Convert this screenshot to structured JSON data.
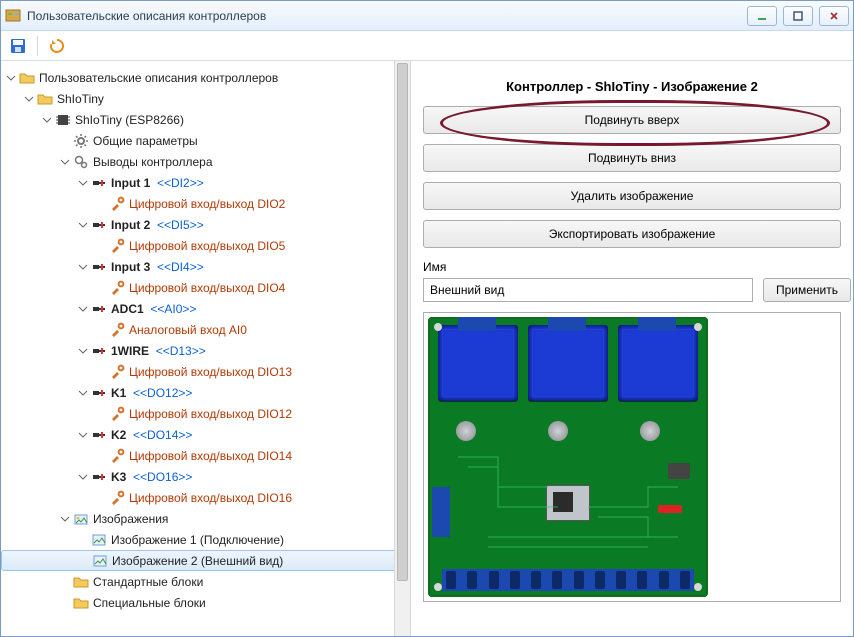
{
  "window": {
    "title": "Пользовательские описания контроллеров"
  },
  "toolbar": {
    "save": "save",
    "refresh": "refresh"
  },
  "tree": {
    "root": "Пользовательские описания контроллеров",
    "controller": "ShIoTiny",
    "device": "ShIoTiny (ESP8266)",
    "common_params": "Общие параметры",
    "pins": "Выводы контроллера",
    "nodes": [
      {
        "name": "Input 1",
        "tag": "<<DI2>>",
        "sub": "Цифровой вход/выход DIO2"
      },
      {
        "name": "Input 2",
        "tag": "<<DI5>>",
        "sub": "Цифровой вход/выход DIO5"
      },
      {
        "name": "Input 3",
        "tag": "<<DI4>>",
        "sub": "Цифровой вход/выход DIO4"
      },
      {
        "name": "ADC1",
        "tag": "<<AI0>>",
        "sub": "Аналоговый вход AI0"
      },
      {
        "name": "1WIRE",
        "tag": "<<D13>>",
        "sub": "Цифровой вход/выход DIO13"
      },
      {
        "name": "K1",
        "tag": "<<DO12>>",
        "sub": "Цифровой вход/выход DIO12"
      },
      {
        "name": "K2",
        "tag": "<<DO14>>",
        "sub": "Цифровой вход/выход DIO14"
      },
      {
        "name": "K3",
        "tag": "<<DO16>>",
        "sub": "Цифровой вход/выход DIO16"
      }
    ],
    "images_node": "Изображения",
    "image1": "Изображение 1 (Подключение)",
    "image2": "Изображение 2 (Внешний вид)",
    "std_blocks": "Стандартные блоки",
    "spec_blocks": "Специальные блоки"
  },
  "right": {
    "title": "Контроллер - ShIoTiny - Изображение 2",
    "btn_up": "Подвинуть вверх",
    "btn_down": "Подвинуть вниз",
    "btn_delete": "Удалить изображение",
    "btn_export": "Экспортировать изображение",
    "name_label": "Имя",
    "name_value": "Внешний вид",
    "apply": "Применить"
  }
}
